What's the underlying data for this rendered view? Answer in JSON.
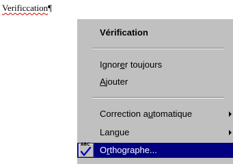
{
  "document": {
    "word": "Verificcation",
    "pilcrow": "¶"
  },
  "context_menu": {
    "header": "Vérification",
    "ignore_all": {
      "before": "Ignor",
      "mnemonic": "e",
      "after": "r toujours"
    },
    "add": {
      "before": "",
      "mnemonic": "A",
      "after": "jouter"
    },
    "autocorrect": {
      "before": "Correction a",
      "mnemonic": "u",
      "after": "tomatique"
    },
    "language": {
      "before": "Lan",
      "mnemonic": "g",
      "after": "ue"
    },
    "spelling": {
      "before": "O",
      "mnemonic": "r",
      "after": "thographe..."
    },
    "spelling_icon": {
      "name": "spell-check-icon",
      "text": "ABC"
    },
    "colors": {
      "menu_bg": "#c0c0c0",
      "highlight_bg": "#000080",
      "highlight_text": "#ffffff",
      "squiggle": "#e00000"
    }
  }
}
